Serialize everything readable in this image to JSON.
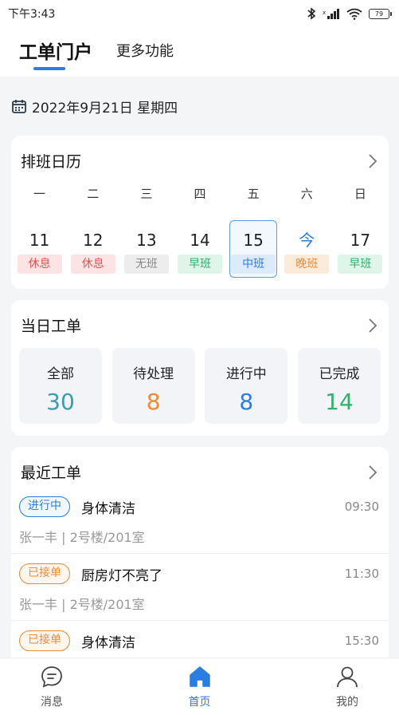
{
  "status_bar": {
    "time": "下午3:43",
    "battery": "79"
  },
  "top_tabs": [
    {
      "label": "工单门户",
      "active": true
    },
    {
      "label": "更多功能",
      "active": false
    }
  ],
  "date_text": "2022年9月21日 星期四",
  "schedule": {
    "title": "排班日历",
    "weekdays": [
      "一",
      "二",
      "三",
      "四",
      "五",
      "六",
      "日"
    ],
    "days": [
      {
        "num": "11",
        "shift": "休息"
      },
      {
        "num": "12",
        "shift": "休息"
      },
      {
        "num": "13",
        "shift": "无班"
      },
      {
        "num": "14",
        "shift": "早班"
      },
      {
        "num": "15",
        "shift": "中班"
      },
      {
        "num": "今",
        "shift": "晚班"
      },
      {
        "num": "17",
        "shift": "早班"
      }
    ]
  },
  "today_orders": {
    "title": "当日工单",
    "stats": [
      {
        "label": "全部",
        "value": "30",
        "color": "#3a9db0"
      },
      {
        "label": "待处理",
        "value": "8",
        "color": "#ef8b35"
      },
      {
        "label": "进行中",
        "value": "8",
        "color": "#2a7de1"
      },
      {
        "label": "已完成",
        "value": "14",
        "color": "#2fb26b"
      }
    ]
  },
  "recent": {
    "title": "最近工单",
    "orders": [
      {
        "tag": "进行中",
        "title": "身体清洁",
        "time": "09:30",
        "sub": "张一丰 | 2号楼/201室"
      },
      {
        "tag": "已接单",
        "title": "厨房灯不亮了",
        "time": "11:30",
        "sub": "张一丰 | 2号楼/201室"
      },
      {
        "tag": "已接单",
        "title": "身体清洁",
        "time": "15:30",
        "sub": ""
      }
    ]
  },
  "bottom_nav": [
    {
      "label": "消息",
      "icon": "message-icon"
    },
    {
      "label": "首页",
      "icon": "home-icon"
    },
    {
      "label": "我的",
      "icon": "profile-icon"
    }
  ],
  "colors": {
    "accent": "#2a7de1",
    "orange": "#ef8b35",
    "green": "#2fb26b",
    "red": "#e05555"
  }
}
